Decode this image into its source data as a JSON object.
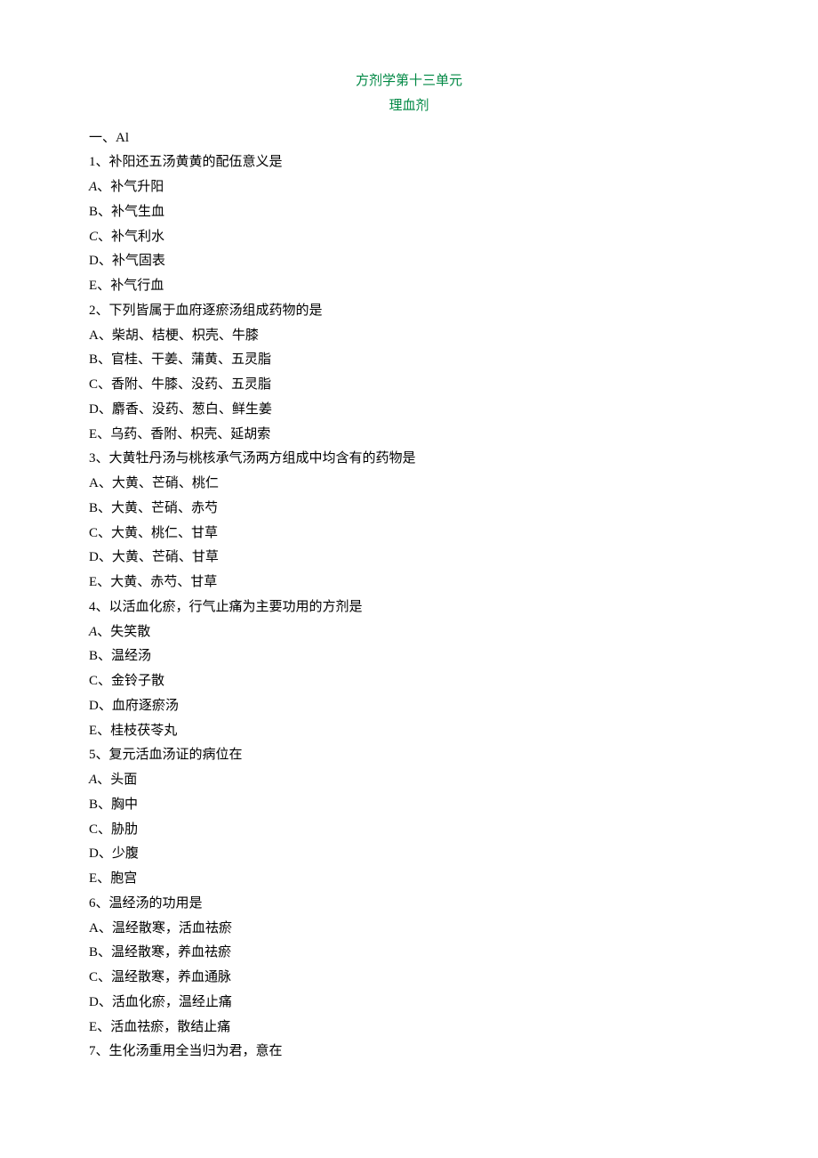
{
  "title": {
    "line1": "方剂学第十三单元",
    "line2": "理血剂"
  },
  "section_heading": "一、Al",
  "questions": [
    {
      "stem": "1、补阳还五汤黄黄的配伍意义是",
      "choices": [
        {
          "letter": "A",
          "text": "补气升阳",
          "italic": true
        },
        {
          "letter": "B",
          "text": "补气生血",
          "italic": false
        },
        {
          "letter": "C",
          "text": "补气利水",
          "italic": true
        },
        {
          "letter": "D",
          "text": "补气固表",
          "italic": false
        },
        {
          "letter": "E",
          "text": "补气行血",
          "italic": false
        }
      ]
    },
    {
      "stem": "2、下列皆属于血府逐瘀汤组成药物的是",
      "choices": [
        {
          "letter": "A",
          "text": "柴胡、桔梗、枳壳、牛膝",
          "italic": false
        },
        {
          "letter": "B",
          "text": "官桂、干姜、蒲黄、五灵脂",
          "italic": false
        },
        {
          "letter": "C",
          "text": "香附、牛膝、没药、五灵脂",
          "italic": false
        },
        {
          "letter": "D",
          "text": "麝香、没药、葱白、鲜生姜",
          "italic": false
        },
        {
          "letter": "E",
          "text": "乌药、香附、枳壳、延胡索",
          "italic": false
        }
      ]
    },
    {
      "stem": "3、大黄牡丹汤与桃核承气汤两方组成中均含有的药物是",
      "choices": [
        {
          "letter": "A",
          "text": "大黄、芒硝、桃仁",
          "italic": false
        },
        {
          "letter": "B",
          "text": "大黄、芒硝、赤芍",
          "italic": false
        },
        {
          "letter": "C",
          "text": "大黄、桃仁、甘草",
          "italic": false
        },
        {
          "letter": "D",
          "text": "大黄、芒硝、甘草",
          "italic": false
        },
        {
          "letter": "E",
          "text": "大黄、赤芍、甘草",
          "italic": false
        }
      ]
    },
    {
      "stem": "4、以活血化瘀，行气止痛为主要功用的方剂是",
      "choices": [
        {
          "letter": "A",
          "text": "失笑散",
          "italic": true
        },
        {
          "letter": "B",
          "text": "温经汤",
          "italic": false
        },
        {
          "letter": "C",
          "text": "金铃子散",
          "italic": false
        },
        {
          "letter": "D",
          "text": "血府逐瘀汤",
          "italic": false
        },
        {
          "letter": "E",
          "text": "桂枝茯苓丸",
          "italic": false
        }
      ]
    },
    {
      "stem": "5、复元活血汤证的病位在",
      "choices": [
        {
          "letter": "A",
          "text": "头面",
          "italic": true
        },
        {
          "letter": "B",
          "text": "胸中",
          "italic": false
        },
        {
          "letter": "C",
          "text": "胁肋",
          "italic": false
        },
        {
          "letter": "D",
          "text": "少腹",
          "italic": false
        },
        {
          "letter": "E",
          "text": "胞宫",
          "italic": false
        }
      ]
    },
    {
      "stem": "6、温经汤的功用是",
      "choices": [
        {
          "letter": "A",
          "text": "温经散寒，活血祛瘀",
          "italic": false
        },
        {
          "letter": "B",
          "text": "温经散寒，养血祛瘀",
          "italic": false
        },
        {
          "letter": "C",
          "text": "温经散寒，养血通脉",
          "italic": false
        },
        {
          "letter": "D",
          "text": "活血化瘀，温经止痛",
          "italic": false
        },
        {
          "letter": "E",
          "text": "活血祛瘀，散结止痛",
          "italic": false
        }
      ]
    },
    {
      "stem": "7、生化汤重用全当归为君，意在",
      "choices": []
    }
  ]
}
